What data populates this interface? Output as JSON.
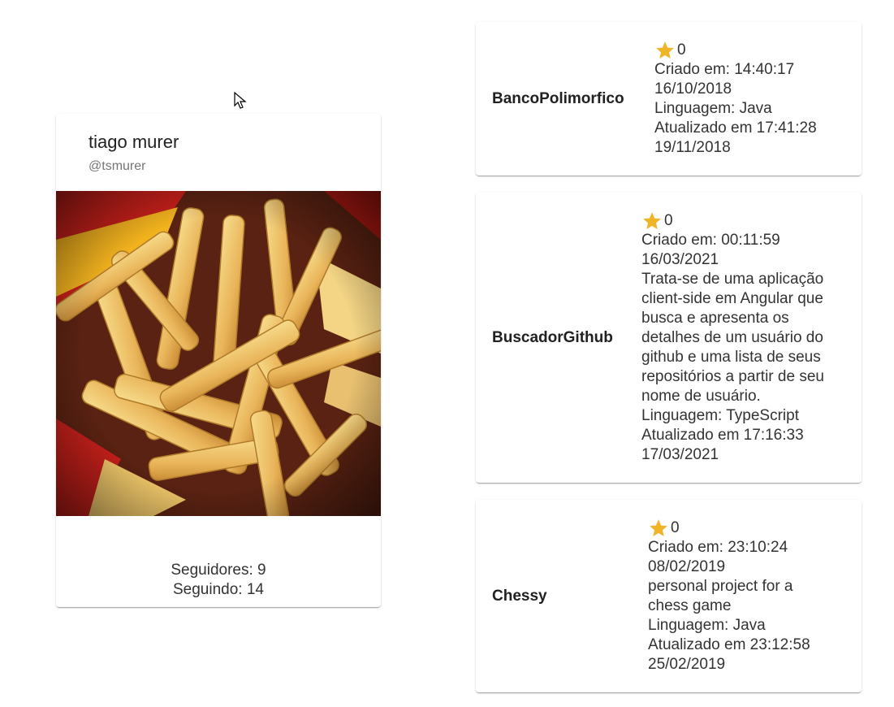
{
  "profile": {
    "name": "tiago murer",
    "login": "@tsmurer",
    "followers": "Seguidores: 9",
    "following": "Seguindo: 14"
  },
  "repos": [
    {
      "name": "BancoPolimorfico",
      "stars": "0",
      "created": "Criado em: 14:40:17",
      "created_date": "16/10/2018",
      "description": "",
      "language": "Linguagem: Java",
      "updated": "Atualizado em 17:41:28",
      "updated_date": "19/11/2018"
    },
    {
      "name": "BuscadorGithub",
      "stars": "0",
      "created": "Criado em: 00:11:59",
      "created_date": "16/03/2021",
      "description_lines": [
        "Trata-se de uma aplicação",
        "client-side em Angular que",
        "busca e apresenta os",
        "detalhes de um usuário do",
        "github e uma lista de seus",
        "repositórios a partir de seu",
        "nome de usuário."
      ],
      "language": "Linguagem: TypeScript",
      "updated": "Atualizado em 17:16:33",
      "updated_date": "17/03/2021"
    },
    {
      "name": "Chessy",
      "stars": "0",
      "created": "Criado em: 23:10:24",
      "created_date": "08/02/2019",
      "description_lines": [
        "personal project for a",
        "chess game"
      ],
      "language": "Linguagem: Java",
      "updated": "Atualizado em 23:12:58",
      "updated_date": "25/02/2019"
    }
  ],
  "colors": {
    "star": "#f0b429",
    "card_bg": "#ffffff"
  },
  "icons": {
    "star": "star-icon",
    "cursor": "mouse-cursor-icon",
    "avatar": "avatar-image"
  }
}
